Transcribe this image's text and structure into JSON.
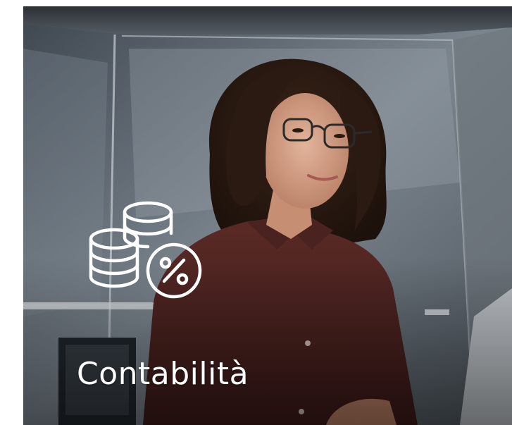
{
  "tile": {
    "title": "Contabilità",
    "icon": "coins-percent-icon",
    "text_color": "#ffffff"
  }
}
